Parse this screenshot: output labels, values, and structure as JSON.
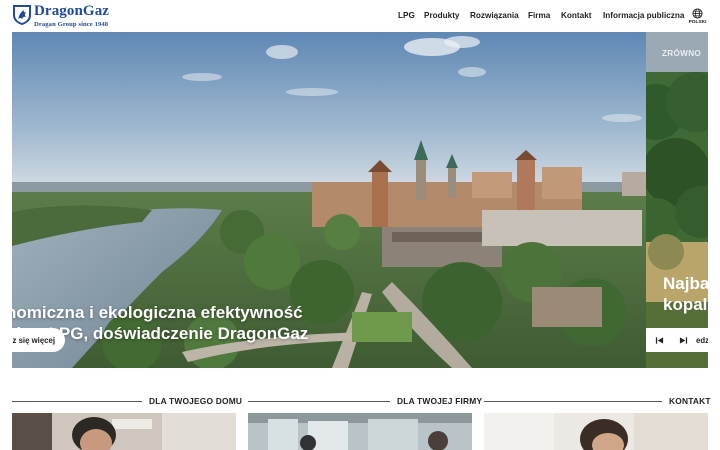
{
  "brand": {
    "name": "DragonGaz",
    "tagline": "Dragan Group since 1948",
    "color": "#1e4c96"
  },
  "nav": {
    "items": [
      {
        "label": "LPG"
      },
      {
        "label": "Produkty"
      },
      {
        "label": "Rozwiązania"
      },
      {
        "label": "Firma"
      },
      {
        "label": "Kontakt"
      },
      {
        "label": "Informacja publiczna"
      }
    ],
    "language": {
      "icon": "globe-icon",
      "label": "POLSKI"
    }
  },
  "hero": {
    "slides": [
      {
        "title_line1": "nomiczna i ekologiczna efektywność",
        "title_line2": "gia z LPG, doświadczenie DragonGaz",
        "button": "z się więcej"
      },
      {
        "tag": "ZRÓWNO",
        "title_line1": "Najba",
        "title_line2": "kopal",
        "more": "edz s"
      }
    ],
    "controls": {
      "prev_icon": "skip-back-icon",
      "next_icon": "skip-forward-icon"
    }
  },
  "sections": [
    {
      "label": "DLA TWOJEGO DOMU"
    },
    {
      "label": "DLA TWOJEJ FIRMY"
    },
    {
      "label": "KONTAKT"
    }
  ]
}
